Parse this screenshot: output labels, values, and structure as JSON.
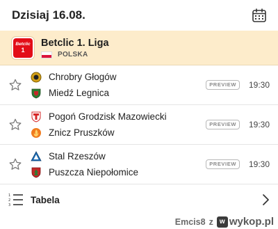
{
  "header": {
    "title": "Dzisiaj 16.08.",
    "calendar_icon": "calendar-icon"
  },
  "league": {
    "name": "Betclic 1. Liga",
    "country": "POLSKA",
    "logo_text": "Betclic",
    "logo_num": "1",
    "logo_color": "#e30d18",
    "background": "#fdeccb"
  },
  "matches": [
    {
      "home": "Chrobry Głogów",
      "away": "Miedź Legnica",
      "badge": "PREVIEW",
      "time": "19:30",
      "home_crest_color": "#d4a017",
      "away_crest_color": "#2e7d32"
    },
    {
      "home": "Pogoń Grodzisk Mazowiecki",
      "away": "Znicz Pruszków",
      "badge": "PREVIEW",
      "time": "19:30",
      "home_crest_color": "#d62828",
      "away_crest_color": "#f07b1e"
    },
    {
      "home": "Stal Rzeszów",
      "away": "Puszcza Niepołomice",
      "badge": "PREVIEW",
      "time": "19:30",
      "home_crest_color": "#1e6fb8",
      "away_crest_color": "#c62828"
    }
  ],
  "footer": {
    "tabela_label": "Tabela",
    "list_icon": "list-numbered-icon",
    "chevron_icon": "chevron-right-icon"
  },
  "watermark": {
    "user": "Emcis8",
    "joiner": "z",
    "site": "wykop.pl",
    "logo_glyph": "w"
  }
}
